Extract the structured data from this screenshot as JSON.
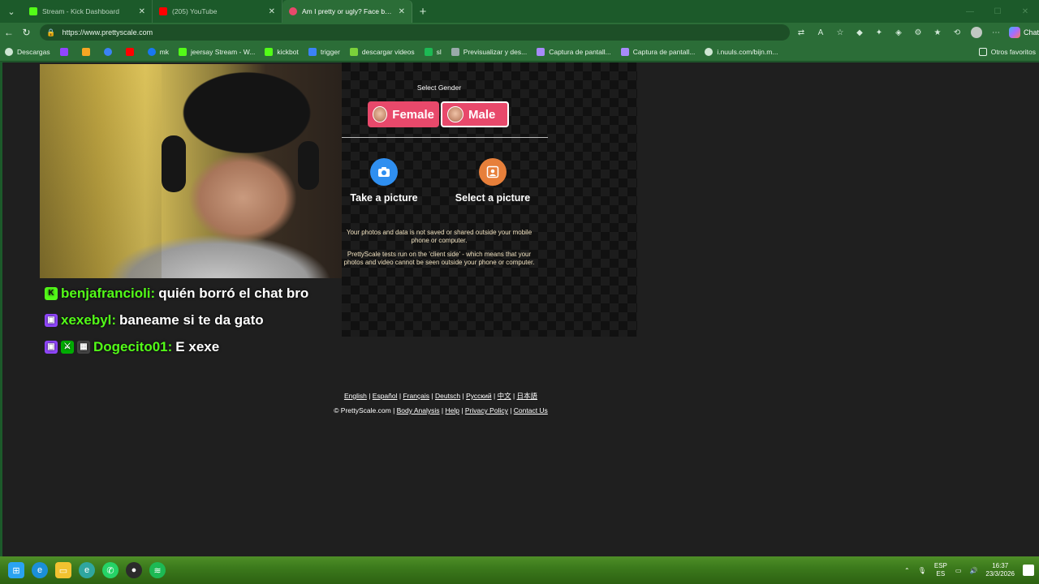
{
  "browser": {
    "tabs": [
      {
        "title": "Stream - Kick Dashboard",
        "color": "#53fc18",
        "active": false
      },
      {
        "title": "(205) YouTube",
        "color": "#ff0000",
        "active": false
      },
      {
        "title": "Am I pretty or ugly? Face beauty a",
        "color": "#e8496b",
        "active": true
      }
    ],
    "url": "https://www.prettyscale.com",
    "bookmarks": [
      {
        "label": "Descargas",
        "color": "#cfe6d3"
      },
      {
        "label": "",
        "color": "#9146ff"
      },
      {
        "label": "",
        "color": "#f5a623"
      },
      {
        "label": "",
        "color": "#3b82f6"
      },
      {
        "label": "",
        "color": "#ff0000"
      },
      {
        "label": "mk",
        "color": "#1877f2"
      },
      {
        "label": "jeersay Stream - W...",
        "color": "#53fc18"
      },
      {
        "label": "kickbot",
        "color": "#53fc18"
      },
      {
        "label": "trigger",
        "color": "#3b82f6"
      },
      {
        "label": "descargar videos",
        "color": "#7bd13a"
      },
      {
        "label": "sl",
        "color": "#1db954"
      },
      {
        "label": "Previsualizar y des...",
        "color": "#9aa"
      },
      {
        "label": "Captura de pantall...",
        "color": "#a78bfa"
      },
      {
        "label": "Captura de pantall...",
        "color": "#a78bfa"
      },
      {
        "label": "i.nuuls.com/bijn.m...",
        "color": "#cfe6d3"
      }
    ],
    "other_bookmarks": "Otros favoritos",
    "chat_label": "Chat"
  },
  "page": {
    "select_gender": "Select Gender",
    "female": "Female",
    "male": "Male",
    "take_picture": "Take a picture",
    "select_picture": "Select a picture",
    "disclaimer1": "Your photos and data is not saved or shared outside your mobile phone or computer.",
    "disclaimer2": "PrettyScale tests run on the 'client side' - which means that your photos and video cannot be seen outside your phone or computer.",
    "languages": [
      "English",
      "Español",
      "Français",
      "Deutsch",
      "Русский",
      "中文",
      "日本語"
    ],
    "copyright": "© PrettyScale.com",
    "footer_links": [
      "Body Analysis",
      "Help",
      "Privacy Policy",
      "Contact Us"
    ]
  },
  "chat": [
    {
      "user": "benjafrancioli:",
      "message": "quién borró el chat bro",
      "badges": [
        "kick"
      ]
    },
    {
      "user": "xexebyl:",
      "message": "baneame si te da gato",
      "badges": [
        "twitch"
      ]
    },
    {
      "user": "Dogecito01:",
      "message": "E xexe",
      "badges": [
        "twitch",
        "mod",
        "qr"
      ]
    }
  ],
  "taskbar": {
    "lang_top": "ESP",
    "lang_bottom": "ES",
    "time": "16:37",
    "date": "23/3/2026"
  }
}
